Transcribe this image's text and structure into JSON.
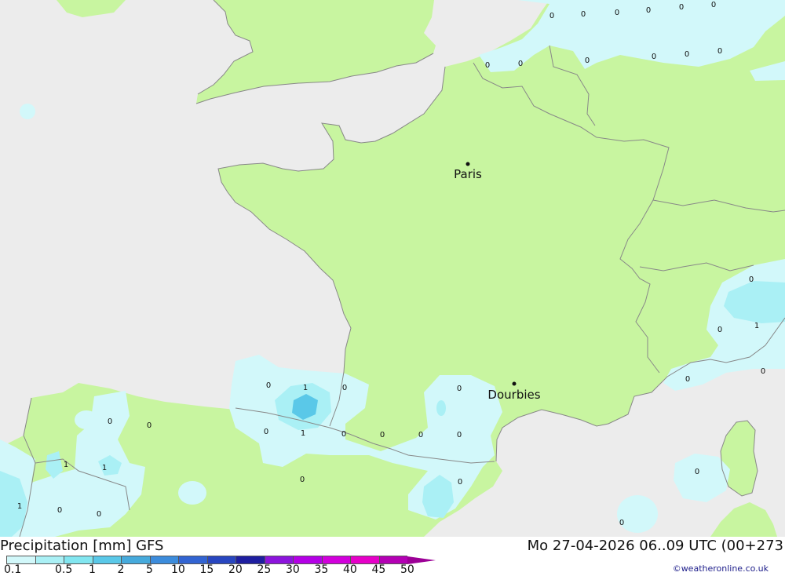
{
  "map": {
    "cities": [
      {
        "name": "Paris",
        "marker": "dot"
      },
      {
        "name": "Dourbies",
        "marker": "dot"
      }
    ],
    "precip_values": [
      "0",
      "0",
      "0",
      "0",
      "0",
      "0",
      "0",
      "0",
      "0",
      "0",
      "0",
      "0",
      "0",
      "0",
      "0",
      "1",
      "0",
      "0",
      "0",
      "1",
      "0",
      "0",
      "1",
      "0",
      "0",
      "0",
      "0",
      "0",
      "0",
      "0",
      "1",
      "1",
      "0",
      "0",
      "1",
      "0",
      "0",
      "0"
    ]
  },
  "footer": {
    "title": "Precipitation [mm] GFS",
    "datetime": "Mo 27-04-2026 06..09 UTC (00+273",
    "credit": "©weatheronline.co.uk"
  },
  "legend": {
    "ticks": [
      "0.1",
      "0.5",
      "1",
      "2",
      "5",
      "10",
      "15",
      "20",
      "25",
      "30",
      "35",
      "40",
      "45",
      "50"
    ],
    "colors": [
      "#d2f8fa",
      "#aaf0f5",
      "#82e6f0",
      "#5ac8e8",
      "#46aadc",
      "#3c8cdc",
      "#3264d2",
      "#2846c0",
      "#1e1ea0",
      "#8c14dc",
      "#b400e6",
      "#d200dc",
      "#e600c8",
      "#b400b4",
      "#9c0096"
    ]
  },
  "colors": {
    "sea": "#ececec",
    "land": "#c8f5a0",
    "border": "#888888"
  }
}
